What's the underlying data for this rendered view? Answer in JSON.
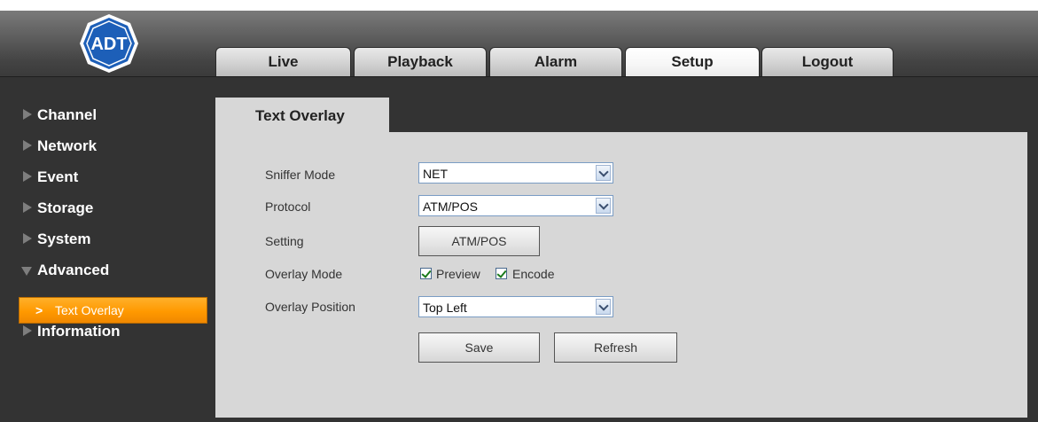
{
  "logo": {
    "text": "ADT"
  },
  "nav_tabs": [
    {
      "label": "Live"
    },
    {
      "label": "Playback"
    },
    {
      "label": "Alarm"
    },
    {
      "label": "Setup"
    },
    {
      "label": "Logout"
    }
  ],
  "active_tab": "Setup",
  "sidebar": {
    "items": [
      {
        "label": "Channel",
        "icon": "triangle-right-icon"
      },
      {
        "label": "Network",
        "icon": "triangle-right-icon"
      },
      {
        "label": "Event",
        "icon": "triangle-right-icon"
      },
      {
        "label": "Storage",
        "icon": "triangle-right-icon"
      },
      {
        "label": "System",
        "icon": "triangle-right-icon"
      },
      {
        "label": "Advanced",
        "icon": "triangle-down-icon"
      },
      {
        "label": "Information",
        "icon": "triangle-right-icon"
      }
    ],
    "active_sub": {
      "label": "Text Overlay",
      "icon": "chevron-right-icon"
    }
  },
  "panel": {
    "title": "Text Overlay",
    "fields": {
      "sniffer_mode": {
        "label": "Sniffer Mode",
        "value": "NET"
      },
      "protocol": {
        "label": "Protocol",
        "value": "ATM/POS"
      },
      "setting": {
        "label": "Setting",
        "button": "ATM/POS"
      },
      "overlay_mode": {
        "label": "Overlay Mode",
        "preview": "Preview",
        "preview_checked": true,
        "encode": "Encode",
        "encode_checked": true
      },
      "overlay_position": {
        "label": "Overlay Position",
        "value": "Top Left"
      }
    },
    "buttons": {
      "save": "Save",
      "refresh": "Refresh"
    }
  },
  "colors": {
    "accent": "#ff9900",
    "background": "#333333",
    "panel": "#d7d7d7"
  }
}
